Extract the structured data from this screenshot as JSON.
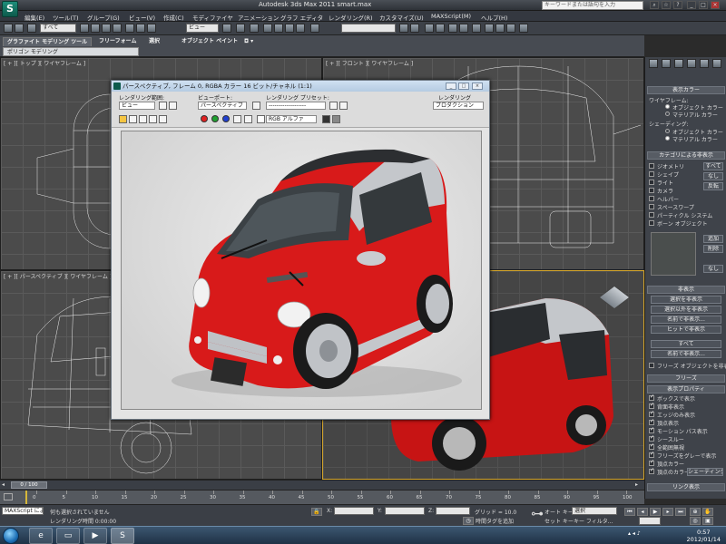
{
  "window": {
    "title": "Autodesk 3ds Max  2011      smart.max",
    "logo": "S",
    "search_placeholder": "キーワードまたは語句を入力"
  },
  "menu": [
    "編集(E)",
    "ツール(T)",
    "グループ(G)",
    "ビュー(V)",
    "作成(C)",
    "モディファイヤ",
    "アニメーション",
    "グラフ エディタ",
    "レンダリング(R)",
    "カスタマイズ(U)",
    "MAXScript(M)",
    "ヘルプ(H)"
  ],
  "toolbar": {
    "selection_filter": "すべて",
    "ref_coord": "ビュー",
    "named_sets": ""
  },
  "ribbon": {
    "tabs": [
      "グラファイト モデリング ツール",
      "フリーフォーム",
      "選択",
      "オブジェクト ペイント"
    ],
    "sub_label": "ポリゴン モデリング"
  },
  "viewports": {
    "top": "[ + ][ トップ ][ ワイヤフレーム ]",
    "front": "[ + ][ フロント ][ ワイヤフレーム ]",
    "left": "[ + ][ パースペクティブ ][ ワイヤフレーム ]",
    "persp": ""
  },
  "render_window": {
    "title": "パースペクティブ, フレーム 0, RGBA カラー 16 ビット/チャネル (1:1)",
    "area_label": "レンダリング範囲:",
    "area_value": "ビュー",
    "viewport_label": "ビューポート:",
    "viewport_value": "パースペクティブ",
    "preset_label": "レンダリング プリセット:",
    "preset_value": "-------------------",
    "render_label": "レンダリング",
    "render_value": "プロダクション",
    "channel_value": "RGB アルファ"
  },
  "command_panel": {
    "display_color_head": "表示カラー",
    "wireframe_label": "ワイヤフレーム:",
    "wire_opt1": "オブジェクト カラー",
    "wire_opt2": "マテリアル カラー",
    "shading_label": "シェーディング:",
    "shade_opt1": "オブジェクト カラー",
    "shade_opt2": "マテリアル カラー",
    "hide_by_category_head": "カテゴリによる非表示",
    "categories": [
      "ジオメトリ",
      "シェイプ",
      "ライト",
      "カメラ",
      "ヘルパー",
      "スペースワープ",
      "パーティクル システム",
      "ボーン オブジェクト"
    ],
    "cat_buttons": [
      "すべて",
      "なし",
      "反転"
    ],
    "add_btn": "追加",
    "remove_btn": "削除",
    "none_btn": "なし",
    "hide_head": "非表示",
    "hide_buttons": [
      "選択を非表示",
      "選択以外を非表示",
      "名前で非表示...",
      "ヒットで非表示",
      "すべて",
      "名前で非表示..."
    ],
    "freeze_check": "フリーズ オブジェクトを非表示",
    "freeze_head": "フリーズ",
    "display_props_head": "表示プロパティ",
    "props": [
      "ボックスで表示",
      "背面非表示",
      "エッジのみ表示",
      "頂点表示",
      "モーション パス表示",
      "シースルー",
      "全範囲無視",
      "フリーズをグレーで表示",
      "頂点カラー",
      "頂点のカラー"
    ],
    "shaded_btn": "シェーディング",
    "link_head": "リンク表示"
  },
  "timeline": {
    "slider_label": "0 / 100",
    "ticks": [
      0,
      5,
      10,
      15,
      20,
      25,
      30,
      35,
      40,
      45,
      50,
      55,
      60,
      65,
      70,
      75,
      80,
      85,
      90,
      95,
      100
    ]
  },
  "status": {
    "maxscript": "MAXScript によう",
    "selection_msg": "何も選択されていません",
    "render_time": "レンダリング時間 0:00:00",
    "x_label": "X:",
    "y_label": "Y:",
    "z_label": "Z:",
    "grid": "グリッド = 10.0",
    "add_time_tag": "時間タグを追加",
    "autokey": "オート キー",
    "setkey": "セット キー",
    "selection_value": "選択",
    "key_filter": "キー フィルタ..."
  },
  "taskbar": {
    "time": "0:57",
    "date": "2012/01/14"
  },
  "colors": {
    "car_red": "#d81a1a",
    "car_silver": "#c4c7cb",
    "swatch": "#4a4e4d",
    "object_color": "#8e1b1b"
  }
}
